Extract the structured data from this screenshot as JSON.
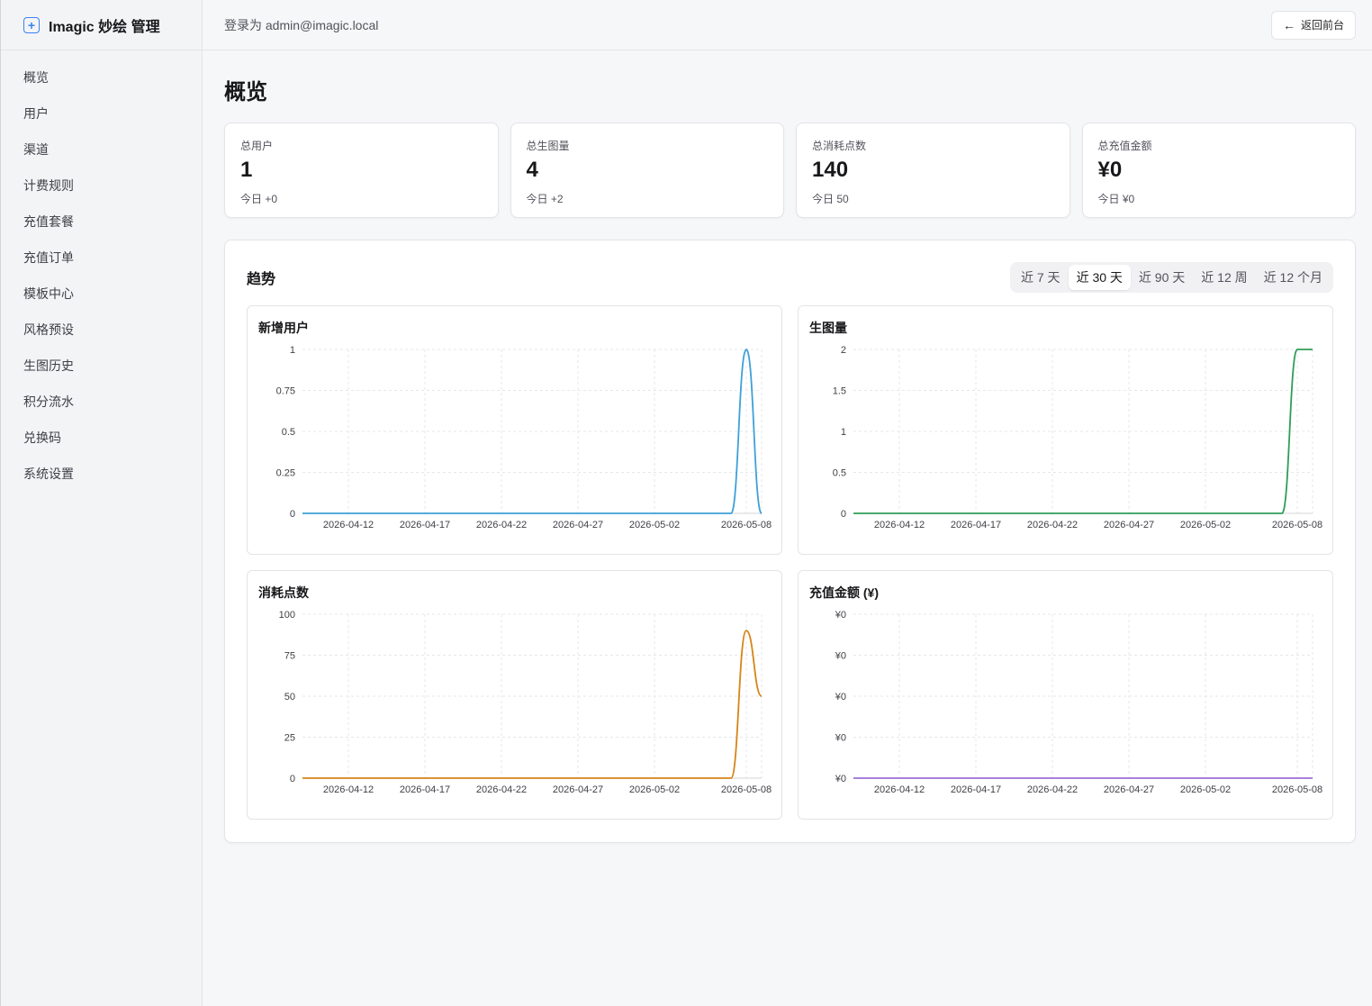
{
  "brand": {
    "name": "Imagic 妙绘 管理",
    "icon": "plus-square-icon"
  },
  "sidebar": {
    "items": [
      {
        "label": "概览"
      },
      {
        "label": "用户"
      },
      {
        "label": "渠道"
      },
      {
        "label": "计费规则"
      },
      {
        "label": "充值套餐"
      },
      {
        "label": "充值订单"
      },
      {
        "label": "模板中心"
      },
      {
        "label": "风格预设"
      },
      {
        "label": "生图历史"
      },
      {
        "label": "积分流水"
      },
      {
        "label": "兑换码"
      },
      {
        "label": "系统设置"
      }
    ]
  },
  "topbar": {
    "login_text": "登录为 admin@imagic.local",
    "back_label": "返回前台",
    "back_icon": "arrow-left-icon"
  },
  "page": {
    "title": "概览"
  },
  "stats": [
    {
      "label": "总用户",
      "value": "1",
      "sub": "今日 +0"
    },
    {
      "label": "总生图量",
      "value": "4",
      "sub": "今日 +2"
    },
    {
      "label": "总消耗点数",
      "value": "140",
      "sub": "今日 50"
    },
    {
      "label": "总充值金额",
      "value": "¥0",
      "sub": "今日 ¥0"
    }
  ],
  "trend": {
    "title": "趋势",
    "ranges": [
      "近 7 天",
      "近 30 天",
      "近 90 天",
      "近 12 周",
      "近 12 个月"
    ],
    "active_range": "近 30 天"
  },
  "chart_data": [
    {
      "type": "line",
      "title": "新增用户",
      "color": "#3ea0d8",
      "x_ticks": [
        "2026-04-12",
        "2026-04-17",
        "2026-04-22",
        "2026-04-27",
        "2026-05-02",
        "2026-05-08"
      ],
      "y_ticks": [
        "0",
        "0.25",
        "0.5",
        "0.75",
        "1"
      ],
      "ylim": [
        0,
        1
      ],
      "x": [
        "2026-04-09",
        "2026-04-10",
        "2026-04-11",
        "2026-04-12",
        "2026-04-13",
        "2026-04-14",
        "2026-04-15",
        "2026-04-16",
        "2026-04-17",
        "2026-04-18",
        "2026-04-19",
        "2026-04-20",
        "2026-04-21",
        "2026-04-22",
        "2026-04-23",
        "2026-04-24",
        "2026-04-25",
        "2026-04-26",
        "2026-04-27",
        "2026-04-28",
        "2026-04-29",
        "2026-04-30",
        "2026-05-01",
        "2026-05-02",
        "2026-05-03",
        "2026-05-04",
        "2026-05-05",
        "2026-05-06",
        "2026-05-07",
        "2026-05-08",
        "2026-05-09"
      ],
      "values": [
        0,
        0,
        0,
        0,
        0,
        0,
        0,
        0,
        0,
        0,
        0,
        0,
        0,
        0,
        0,
        0,
        0,
        0,
        0,
        0,
        0,
        0,
        0,
        0,
        0,
        0,
        0,
        0,
        0,
        1,
        0
      ]
    },
    {
      "type": "line",
      "title": "生图量",
      "color": "#2e9e57",
      "x_ticks": [
        "2026-04-12",
        "2026-04-17",
        "2026-04-22",
        "2026-04-27",
        "2026-05-02",
        "2026-05-08"
      ],
      "y_ticks": [
        "0",
        "0.5",
        "1",
        "1.5",
        "2"
      ],
      "ylim": [
        0,
        2
      ],
      "x": [
        "2026-04-09",
        "2026-04-10",
        "2026-04-11",
        "2026-04-12",
        "2026-04-13",
        "2026-04-14",
        "2026-04-15",
        "2026-04-16",
        "2026-04-17",
        "2026-04-18",
        "2026-04-19",
        "2026-04-20",
        "2026-04-21",
        "2026-04-22",
        "2026-04-23",
        "2026-04-24",
        "2026-04-25",
        "2026-04-26",
        "2026-04-27",
        "2026-04-28",
        "2026-04-29",
        "2026-04-30",
        "2026-05-01",
        "2026-05-02",
        "2026-05-03",
        "2026-05-04",
        "2026-05-05",
        "2026-05-06",
        "2026-05-07",
        "2026-05-08",
        "2026-05-09"
      ],
      "values": [
        0,
        0,
        0,
        0,
        0,
        0,
        0,
        0,
        0,
        0,
        0,
        0,
        0,
        0,
        0,
        0,
        0,
        0,
        0,
        0,
        0,
        0,
        0,
        0,
        0,
        0,
        0,
        0,
        0,
        2,
        2
      ]
    },
    {
      "type": "line",
      "title": "消耗点数",
      "color": "#d68418",
      "x_ticks": [
        "2026-04-12",
        "2026-04-17",
        "2026-04-22",
        "2026-04-27",
        "2026-05-02",
        "2026-05-08"
      ],
      "y_ticks": [
        "0",
        "25",
        "50",
        "75",
        "100"
      ],
      "ylim": [
        0,
        100
      ],
      "x": [
        "2026-04-09",
        "2026-04-10",
        "2026-04-11",
        "2026-04-12",
        "2026-04-13",
        "2026-04-14",
        "2026-04-15",
        "2026-04-16",
        "2026-04-17",
        "2026-04-18",
        "2026-04-19",
        "2026-04-20",
        "2026-04-21",
        "2026-04-22",
        "2026-04-23",
        "2026-04-24",
        "2026-04-25",
        "2026-04-26",
        "2026-04-27",
        "2026-04-28",
        "2026-04-29",
        "2026-04-30",
        "2026-05-01",
        "2026-05-02",
        "2026-05-03",
        "2026-05-04",
        "2026-05-05",
        "2026-05-06",
        "2026-05-07",
        "2026-05-08",
        "2026-05-09"
      ],
      "values": [
        0,
        0,
        0,
        0,
        0,
        0,
        0,
        0,
        0,
        0,
        0,
        0,
        0,
        0,
        0,
        0,
        0,
        0,
        0,
        0,
        0,
        0,
        0,
        0,
        0,
        0,
        0,
        0,
        0,
        90,
        50
      ]
    },
    {
      "type": "line",
      "title": "充值金额 (¥)",
      "color": "#9b6fd6",
      "x_ticks": [
        "2026-04-12",
        "2026-04-17",
        "2026-04-22",
        "2026-04-27",
        "2026-05-02",
        "2026-05-08"
      ],
      "y_ticks": [
        "¥0",
        "¥0",
        "¥0",
        "¥0",
        "¥0"
      ],
      "ylim": [
        0,
        1
      ],
      "x": [
        "2026-04-09",
        "2026-04-10",
        "2026-04-11",
        "2026-04-12",
        "2026-04-13",
        "2026-04-14",
        "2026-04-15",
        "2026-04-16",
        "2026-04-17",
        "2026-04-18",
        "2026-04-19",
        "2026-04-20",
        "2026-04-21",
        "2026-04-22",
        "2026-04-23",
        "2026-04-24",
        "2026-04-25",
        "2026-04-26",
        "2026-04-27",
        "2026-04-28",
        "2026-04-29",
        "2026-04-30",
        "2026-05-01",
        "2026-05-02",
        "2026-05-03",
        "2026-05-04",
        "2026-05-05",
        "2026-05-06",
        "2026-05-07",
        "2026-05-08",
        "2026-05-09"
      ],
      "values": [
        0,
        0,
        0,
        0,
        0,
        0,
        0,
        0,
        0,
        0,
        0,
        0,
        0,
        0,
        0,
        0,
        0,
        0,
        0,
        0,
        0,
        0,
        0,
        0,
        0,
        0,
        0,
        0,
        0,
        0,
        0
      ]
    }
  ]
}
